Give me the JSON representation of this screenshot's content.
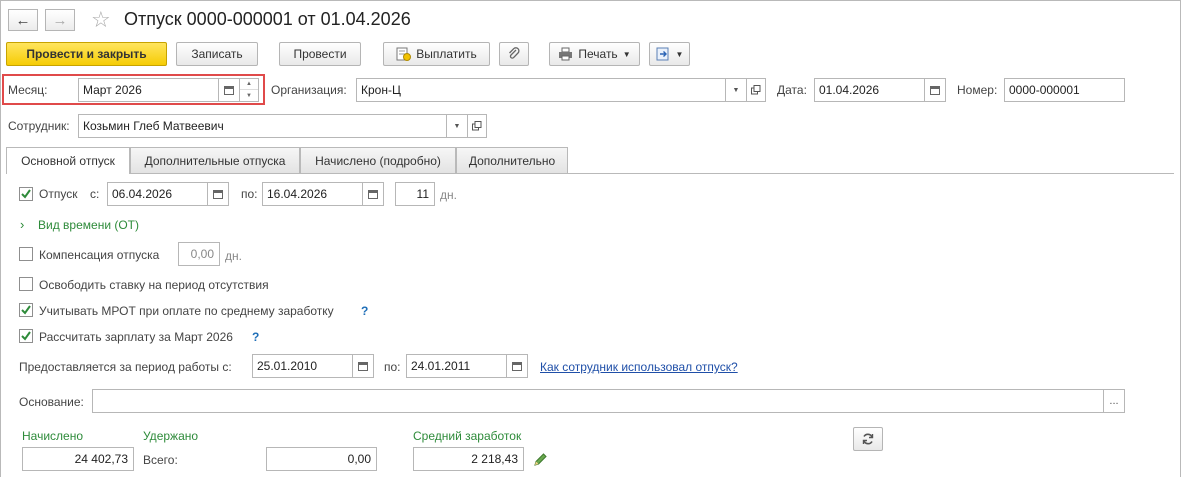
{
  "window": {
    "title": "Отпуск 0000-000001 от 01.04.2026"
  },
  "toolbar": {
    "post_close": "Провести и закрыть",
    "save": "Записать",
    "post": "Провести",
    "pay": "Выплатить",
    "print": "Печать"
  },
  "header": {
    "month_label": "Месяц:",
    "month_value": "Март 2026",
    "org_label": "Организация:",
    "org_value": "Крон-Ц",
    "date_label": "Дата:",
    "date_value": "01.04.2026",
    "number_label": "Номер:",
    "number_value": "0000-000001",
    "employee_label": "Сотрудник:",
    "employee_value": "Козьмин Глеб Матвеевич"
  },
  "tabs": [
    {
      "label": "Основной отпуск",
      "active": true
    },
    {
      "label": "Дополнительные отпуска",
      "active": false
    },
    {
      "label": "Начислено (подробно)",
      "active": false
    },
    {
      "label": "Дополнительно",
      "active": false
    }
  ],
  "vacation": {
    "checked": true,
    "label": "Отпуск",
    "from_label": "с:",
    "from_value": "06.04.2026",
    "to_label": "по:",
    "to_value": "16.04.2026",
    "days_value": "11",
    "days_unit": "дн."
  },
  "time_type": {
    "label": "Вид времени (ОТ)"
  },
  "compensation": {
    "checked": false,
    "label": "Компенсация отпуска",
    "value": "0,00",
    "unit": "дн."
  },
  "free_rate": {
    "checked": false,
    "label": "Освободить ставку на период отсутствия"
  },
  "mrot": {
    "checked": true,
    "label": "Учитывать МРОТ при оплате по среднему заработку",
    "help": "?"
  },
  "calc_salary": {
    "checked": true,
    "label": "Рассчитать зарплату за Март 2026",
    "help": "?"
  },
  "period": {
    "label": "Предоставляется за период работы с:",
    "from_value": "25.01.2010",
    "to_label": "по:",
    "to_value": "24.01.2011",
    "link": "Как сотрудник использовал отпуск?"
  },
  "basis": {
    "label": "Основание:",
    "value": "",
    "more": "..."
  },
  "totals": {
    "accrued_label": "Начислено",
    "accrued_value": "24 402,73",
    "withheld_label": "Удержано",
    "total_label": "Всего:",
    "withheld_value": "0,00",
    "avg_label": "Средний заработок",
    "avg_value": "2 218,43"
  },
  "colors": {
    "accent_yellow": "#f6cc05",
    "green_text": "#2e8b3a",
    "link_blue": "#1f4fa8",
    "highlight_red": "#e04a4a"
  }
}
